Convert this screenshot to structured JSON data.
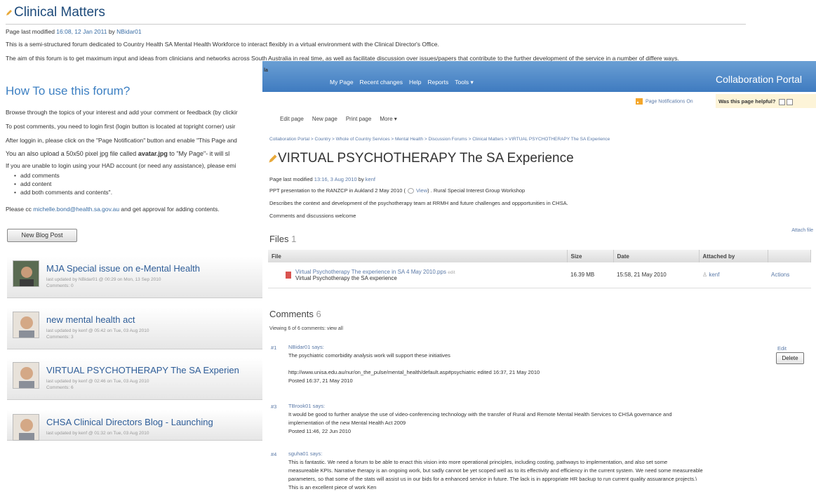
{
  "back": {
    "title": "Clinical Matters",
    "modified_prefix": "Page last modified ",
    "modified_date": "16:08, 12 Jan 2011",
    "modified_by_word": " by ",
    "modified_user": "NBidar01",
    "intro1": "This is a semi-structured forum dedicated to Country Health SA Mental Health Workforce to interact flexibly in a virtual environment with the Clinical Director's Office.",
    "intro2": "The aim of this forum is to get maximum input and ideas from clinicians and networks across South Australia in real time, as well as facilitate discussion over issues/papers that contribute to the further development of the service in a number of differe ways.",
    "howto_heading": "How To use this forum?",
    "p1": "Browse through the topics of your interest and add your comment or feedback (by clickir",
    "p2": "To post comments, you need to login first (login button is located at topright corner) usir",
    "p3": "After loggin in, please click on the \"Page Notification\" button and enable \"This Page and",
    "p4_a": "You an also upload a 50x50 pixel jpg file called ",
    "p4_b": "avatar.jpg",
    "p4_c": " to \"My Page\"-  it will sl",
    "p5": "If you are unable to login using your HAD account (or need any assistance), please emi",
    "list": [
      "add comments",
      "add content",
      "add both comments and contents\"."
    ],
    "cc_a": "Please cc ",
    "cc_email": "michelle.bond@health.sa.gov.au",
    "cc_b": " and get approval for adding contents.",
    "new_blog_button": "New Blog Post",
    "posts": [
      {
        "title": "MJA Special issue on e-Mental Health",
        "meta": "last updated by NBidar01 @ 00:29 on Mon, 13 Sep 2010",
        "comments": "Comments: 0"
      },
      {
        "title": "new mental health act",
        "meta": "last updated by kenf @ 05:42 on Tue, 03 Aug 2010",
        "comments": "Comments: 3"
      },
      {
        "title": "VIRTUAL PSYCHOTHERAPY The SA Experien",
        "meta": "last updated by kenf @ 02:46 on Tue, 03 Aug 2010",
        "comments": "Comments: 6"
      },
      {
        "title": "CHSA Clinical Directors Blog - Launching",
        "meta": "last updated by kenf @ 01:32 on Tue, 03 Aug 2010",
        "comments": ""
      }
    ]
  },
  "front": {
    "stub": "la",
    "nav": [
      "My Page",
      "Recent changes",
      "Help",
      "Reports",
      "Tools ▾"
    ],
    "portal_name": "Collaboration Portal",
    "page_notifications": "Page Notifications On",
    "helpful_question": "Was this page helpful?",
    "page_actions": [
      "Edit page",
      "New page",
      "Print page",
      "More ▾"
    ],
    "breadcrumb": "Collaboration Portal > Country > Whole of Country Services > Mental Health > Discussion Forums > Clinical Matters > VIRTUAL PSYCHOTHERAPY The SA Experience",
    "title": "VIRTUAL PSYCHOTHERAPY The SA Experience",
    "modified_prefix": "Page last modified ",
    "modified_date": "13:16, 3 Aug 2010",
    "modified_by_word": " by ",
    "modified_user": "kenf",
    "desc1_a": "PPT presentation to the RANZCP in Aukland 2 May 2010 (",
    "desc1_link": "View",
    "desc1_b": ") . Rural Special Interest Group Workshop",
    "desc2": "Describes the context and development of the psychotherapy team at RRMH and future challenges and oppportunities in CHSA.",
    "desc3": "Comments and discussions welcome",
    "files_heading": "Files",
    "files_count": "1",
    "attach_file": "Attach file",
    "table_headers": [
      "File",
      "Size",
      "Date",
      "Attached by",
      ""
    ],
    "file": {
      "name": "Virtual Psychotherapy The experience in SA 4 May 2010.pps",
      "edit": "edit",
      "description": "Virtual Psychotherapy the SA experience",
      "size": "16.39 MB",
      "date": "15:58, 21 May 2010",
      "attached_by": "kenf",
      "actions": "Actions"
    },
    "comments_heading": "Comments",
    "comments_count": "6",
    "viewing": "Viewing 6 of 6 comments: view all",
    "edit_link": "Edit",
    "delete_button": "Delete",
    "comments": [
      {
        "num": "#1",
        "user": "NBidar01",
        "says": " says:",
        "lines": [
          "The psychiatric comorbidity analysis work will support these initiatives",
          "",
          "http://www.unisa.edu.au/nur/on_the_pulse/mental_health/default.asp#psychiatric edited 16:37, 21 May 2010",
          "Posted 16:37, 21 May 2010"
        ]
      },
      {
        "num": "#3",
        "user": "TBrook01",
        "says": " says:",
        "lines": [
          "It would be good to further analyse the use of video-conferencing technology with the transfer of Rural and Remote Mental Health Services to CHSA governance and",
          "implementation of the new Mental Health Act 2009",
          "Posted 11:46, 22 Jun 2010"
        ]
      },
      {
        "num": "#4",
        "user": "sguha01",
        "says": " says:",
        "lines": [
          "This is fantastic. We need a forum to be able to enact this vision into more operational principles, including costing, pathways to implementation, and also set some",
          "measureable KPIs. Narrative therapy is an ongoing work, but sadly cannot be yet scoped well as to its effectivity and efficiency in the current system. We need some measureable",
          "parameters, so that some of the stats will assist us in our bids for a enhanced service in future. The lack is in appropriate HR backup to run current quality assuarance projects.\\",
          "This is an excellent piece of work Ken"
        ]
      }
    ]
  },
  "colors": {
    "accent_blue": "#3f7bc0",
    "link_blue": "#5b7aa8",
    "heading_blue": "#3c7fc2",
    "helpful_bg": "#fdf4d8"
  }
}
